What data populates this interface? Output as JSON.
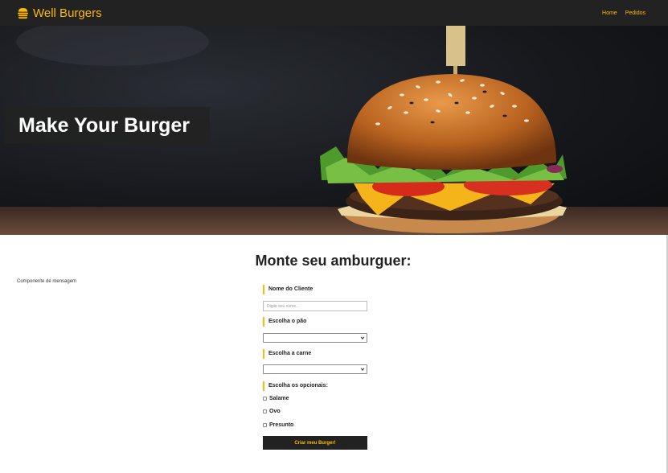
{
  "navbar": {
    "brand": "Well Burgers",
    "brand_icon": "burger-icon",
    "links": [
      "Home",
      "Pedidos"
    ]
  },
  "hero": {
    "title": "Make Your Burger"
  },
  "main": {
    "heading": "Monte seu amburguer:",
    "message": "Componente de mensagem"
  },
  "form": {
    "name_label": "Nome do Cliente",
    "name_placeholder": "Digite seu nome...",
    "bread_label": "Escolha o pão",
    "meat_label": "Escolha a carne",
    "optionals_label": "Escolha os opcionais:",
    "optionals": [
      "Salame",
      "Ovo",
      "Presunto"
    ],
    "submit_label": "Criar meu Burger!"
  },
  "colors": {
    "accent": "#fcba03",
    "navbar": "#222222"
  }
}
